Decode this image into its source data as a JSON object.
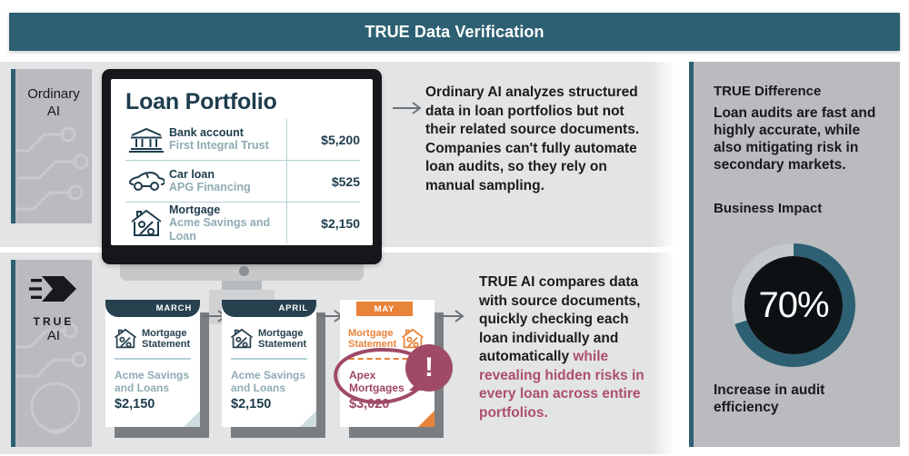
{
  "header": {
    "title": "TRUE Data Verification"
  },
  "sidebar": {
    "top_label": "Ordinary\nAI",
    "top_label_line1": "Ordinary",
    "top_label_line2": "AI",
    "bottom_logo_icon": "true-ai-logo-icon",
    "bottom_wordmark": "TRUE",
    "bottom_label": "AI"
  },
  "monitor": {
    "screen_title": "Loan Portfolio",
    "rows": [
      {
        "icon": "bank-icon",
        "name": "Bank account",
        "org": "First Integral Trust",
        "amount": "$5,200"
      },
      {
        "icon": "car-icon",
        "name": "Car loan",
        "org": "APG Financing",
        "amount": "$525"
      },
      {
        "icon": "house-percent-icon",
        "name": "Mortgage",
        "org": "Acme Savings and Loan",
        "amount": "$2,150"
      }
    ]
  },
  "top_paragraph": "Ordinary AI analyzes structured data in loan portfolios but not their related source documents. Companies can't fully automate loan audits, so they rely on manual sampling.",
  "bottom_paragraph": {
    "bold_lead": "TRUE AI",
    "black_text": " compares data with source documents, quickly checking each loan individually and automatically ",
    "rose_text": "while revealing hidden risks in every loan across entire portfolios."
  },
  "statements": [
    {
      "month": "MARCH",
      "doc_title": "Mortgage\nStatement",
      "doc_title_line1": "Mortgage",
      "doc_title_line2": "Statement",
      "icon": "house-percent-icon",
      "org_line1": "Acme Savings",
      "org_line2": "and Loans",
      "amount": "$2,150",
      "highlight": false
    },
    {
      "month": "APRIL",
      "doc_title_line1": "Mortgage",
      "doc_title_line2": "Statement",
      "icon": "house-percent-icon",
      "org_line1": "Acme Savings",
      "org_line2": "and Loans",
      "amount": "$2,150",
      "highlight": false
    },
    {
      "month": "MAY",
      "doc_title_line1": "Mortgage",
      "doc_title_line2": "Statement",
      "icon": "house-percent-icon",
      "org_line1": "Apex",
      "org_line2": "Mortgages",
      "amount": "$3,020",
      "highlight": true,
      "alert_icon": "exclamation-badge-icon"
    }
  ],
  "right_panel": {
    "heading": "TRUE Difference",
    "body": "Loan audits are fast and highly accurate, while also mitigating risk in secondary markets.",
    "impact_heading": "Business Impact",
    "caption": "Increase in audit efficiency"
  },
  "chart_data": {
    "type": "pie",
    "title": "Business Impact",
    "categories": [
      "Increase in audit efficiency",
      "Remainder"
    ],
    "values": [
      70,
      30
    ],
    "value_label": "70%",
    "colors": [
      "#2d6072",
      "#c6c9cb"
    ],
    "inner_color": "#0d1114",
    "annotation": "Increase in audit efficiency",
    "legend": "none"
  },
  "colors": {
    "teal": "#2d6072",
    "dark_teal": "#27414f",
    "panel_grey": "#b9bbbe",
    "band_grey": "#e3e4e5",
    "orange": "#e8833a",
    "wine": "#a04a68",
    "rose_text": "#ad4f6d",
    "muted_blue": "#8fabb3"
  }
}
